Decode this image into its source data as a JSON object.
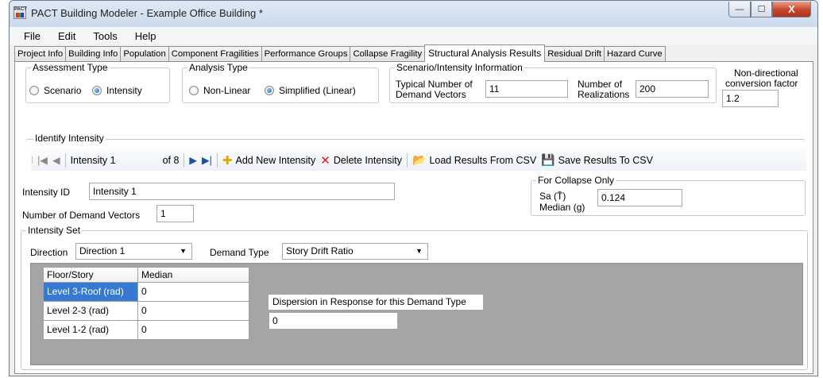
{
  "window": {
    "title": "PACT Building Modeler - Example Office Building *",
    "icon_text": "PACT",
    "min_glyph": "—",
    "max_glyph": "☐",
    "close_glyph": "X"
  },
  "menu": [
    "File",
    "Edit",
    "Tools",
    "Help"
  ],
  "tabs": [
    "Project Info",
    "Building Info",
    "Population",
    "Component Fragilities",
    "Performance Groups",
    "Collapse Fragility",
    "Structural Analysis Results",
    "Residual Drift",
    "Hazard Curve"
  ],
  "active_tab": "Structural Analysis Results",
  "assessment_type": {
    "title": "Assessment Type",
    "options": [
      "Scenario",
      "Intensity"
    ],
    "selected": "Intensity"
  },
  "analysis_type": {
    "title": "Analysis Type",
    "options": [
      "Non-Linear",
      "Simplified (Linear)"
    ],
    "selected": "Simplified (Linear)"
  },
  "scenario_info": {
    "title": "Scenario/Intensity Information",
    "typical_label_1": "Typical Number of",
    "typical_label_2": "Demand Vectors",
    "typical_value": "11",
    "realizations_label_1": "Number of",
    "realizations_label_2": "Realizations",
    "realizations_value": "200"
  },
  "nondirectional": {
    "label_1": "Non-directional",
    "label_2": "conversion factor",
    "value": "1.2"
  },
  "identify_intensity": {
    "title": "Identify Intensity",
    "nav_first": "|◀",
    "nav_prev": "◀",
    "current_value": "Intensity 1",
    "count_text": "of 8",
    "nav_next": "▶",
    "nav_last": "▶|",
    "add_label": "Add New Intensity",
    "delete_label": "Delete Intensity",
    "load_label": "Load Results From CSV",
    "save_label": "Save Results To CSV"
  },
  "intensity": {
    "id_label": "Intensity ID",
    "id_value": "Intensity 1",
    "demand_vectors_label": "Number of Demand Vectors",
    "demand_vectors_value": "1"
  },
  "collapse_only": {
    "title": "For Collapse Only",
    "sa_label": "Sa (T̄)",
    "median_label": "Median (g)",
    "value": "0.124"
  },
  "intensity_set": {
    "title": "Intensity Set",
    "direction_label": "Direction",
    "direction_value": "Direction 1",
    "demand_type_label": "Demand Type",
    "demand_type_value": "Story Drift Ratio",
    "grid_headers": [
      "Floor/Story",
      "Median"
    ],
    "grid_rows": [
      {
        "floor": "Level 3-Roof (rad)",
        "median": "0"
      },
      {
        "floor": "Level 2-3 (rad)",
        "median": "0"
      },
      {
        "floor": "Level 1-2 (rad)",
        "median": "0"
      }
    ],
    "dispersion_label": "Dispersion in Response for this Demand Type",
    "dispersion_value": "0"
  }
}
